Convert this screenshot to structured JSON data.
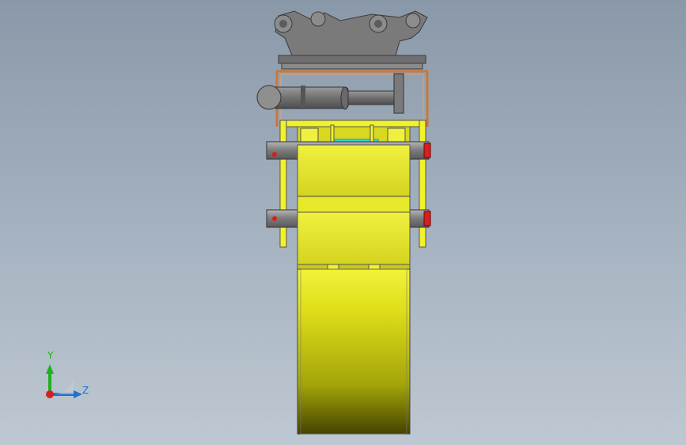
{
  "viewport": {
    "background_top": "#8a99a9",
    "background_bottom": "#bec8d2"
  },
  "triad": {
    "y_label": "Y",
    "z_label": "Z",
    "y_color": "#1db31d",
    "z_color": "#1f6fd1",
    "x_color": "#d61f1f"
  },
  "model": {
    "quick_coupler_color": "#7d7d7d",
    "bracket_color": "#c8783a",
    "frame_color": "#f2f229",
    "drum_color": "#e6e61a",
    "pin_color": "#8d8d8d",
    "pin_cap_color": "#d42020",
    "accent_color": "#35d8d8"
  }
}
